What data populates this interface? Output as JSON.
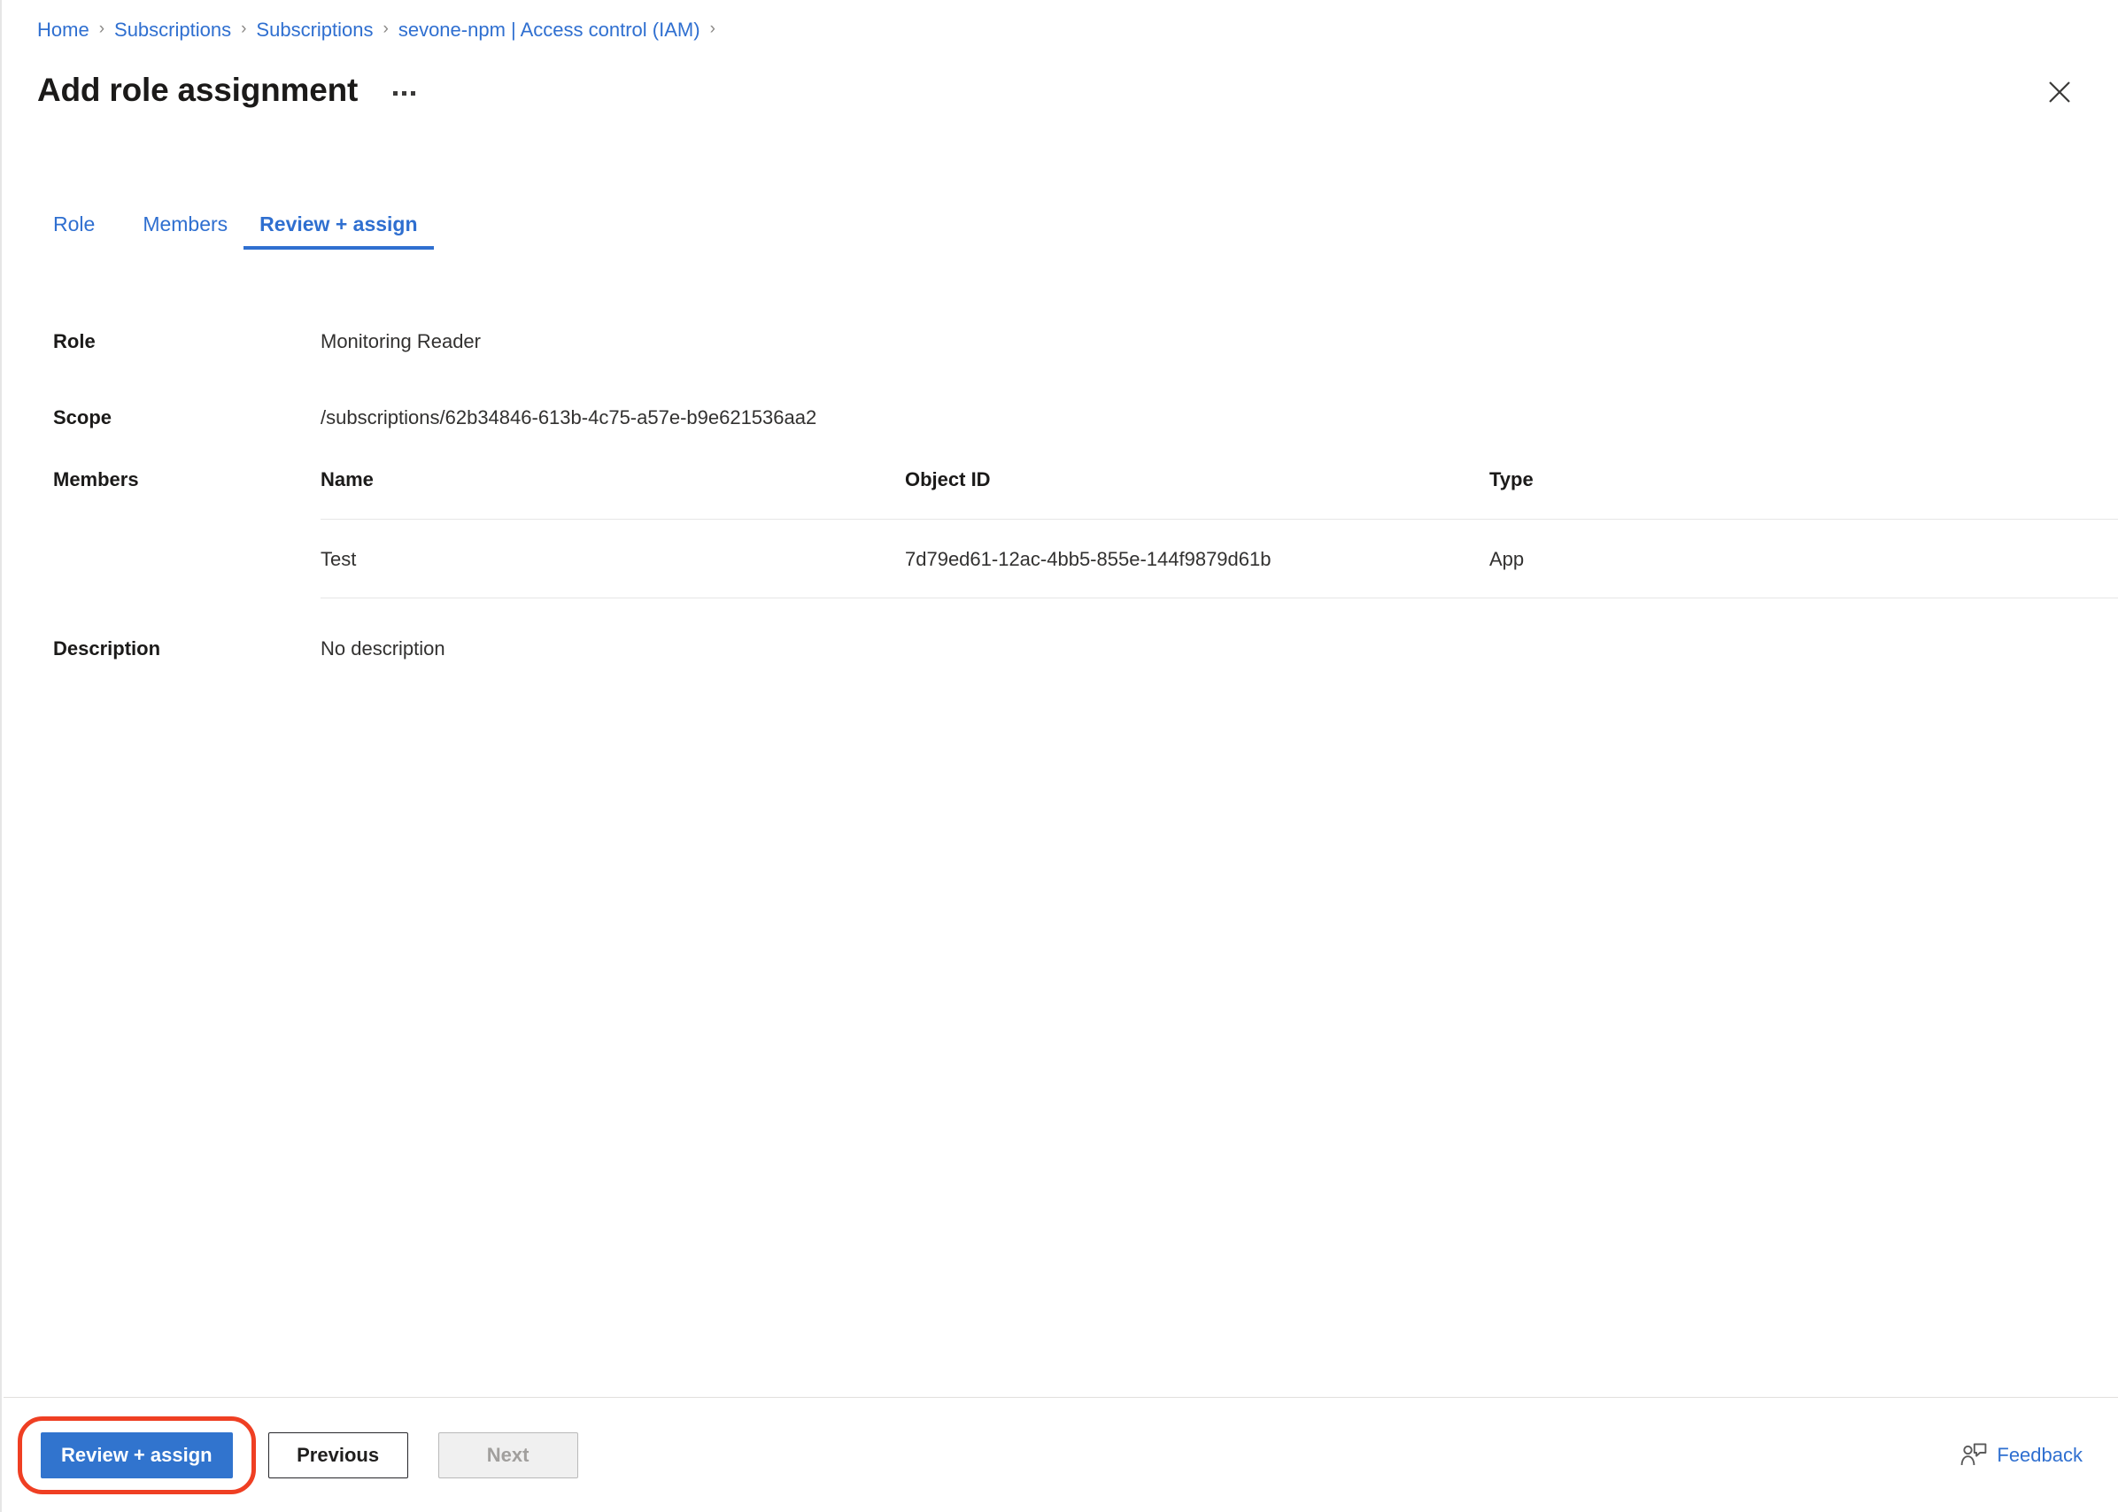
{
  "breadcrumb": {
    "items": [
      {
        "label": "Home"
      },
      {
        "label": "Subscriptions"
      },
      {
        "label": "Subscriptions"
      },
      {
        "label": "sevone-npm | Access control (IAM)"
      }
    ],
    "separator": "›"
  },
  "header": {
    "title": "Add role assignment",
    "more_icon": "ellipsis-icon",
    "close_icon": "close-icon"
  },
  "tabs": [
    {
      "label": "Role",
      "active": false
    },
    {
      "label": "Members",
      "active": false
    },
    {
      "label": "Review + assign",
      "active": true
    }
  ],
  "fields": {
    "role": {
      "label": "Role",
      "value": "Monitoring Reader"
    },
    "scope": {
      "label": "Scope",
      "value": "/subscriptions/62b34846-613b-4c75-a57e-b9e621536aa2"
    },
    "members": {
      "label": "Members"
    },
    "description": {
      "label": "Description",
      "value": "No description"
    }
  },
  "members_table": {
    "columns": [
      "Name",
      "Object ID",
      "Type"
    ],
    "rows": [
      {
        "name": "Test",
        "object_id": "7d79ed61-12ac-4bb5-855e-144f9879d61b",
        "type": "App"
      }
    ]
  },
  "footer": {
    "primary_label": "Review + assign",
    "previous_label": "Previous",
    "next_label": "Next",
    "feedback_label": "Feedback",
    "feedback_icon": "feedback-person-icon"
  },
  "colors": {
    "accent_blue": "#3174ce",
    "link_blue": "#2f6fd0",
    "annotation_red": "#ef3f23",
    "disabled_text": "#a19f9d",
    "border_gray": "#e6e6e6"
  }
}
